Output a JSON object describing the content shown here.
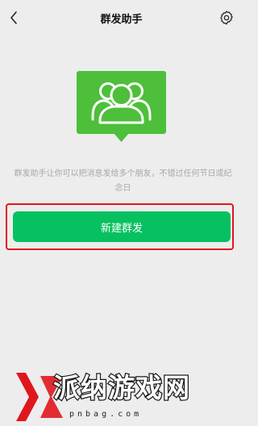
{
  "navbar": {
    "title": "群发助手",
    "back_icon": "chevron-left-icon",
    "settings_icon": "gear-icon"
  },
  "illustration": {
    "icon": "group-people-icon",
    "color": "#4dbf3a"
  },
  "main": {
    "description": "群发助手让你可以把消息发给多个朋友，不错过任何节日或纪念日",
    "new_broadcast_label": "新建群发"
  },
  "colors": {
    "primary": "#07c160",
    "background": "#ededed",
    "highlight": "#e0161e"
  },
  "watermark": {
    "text": "派纳游戏网",
    "url": "pnbag.com"
  }
}
